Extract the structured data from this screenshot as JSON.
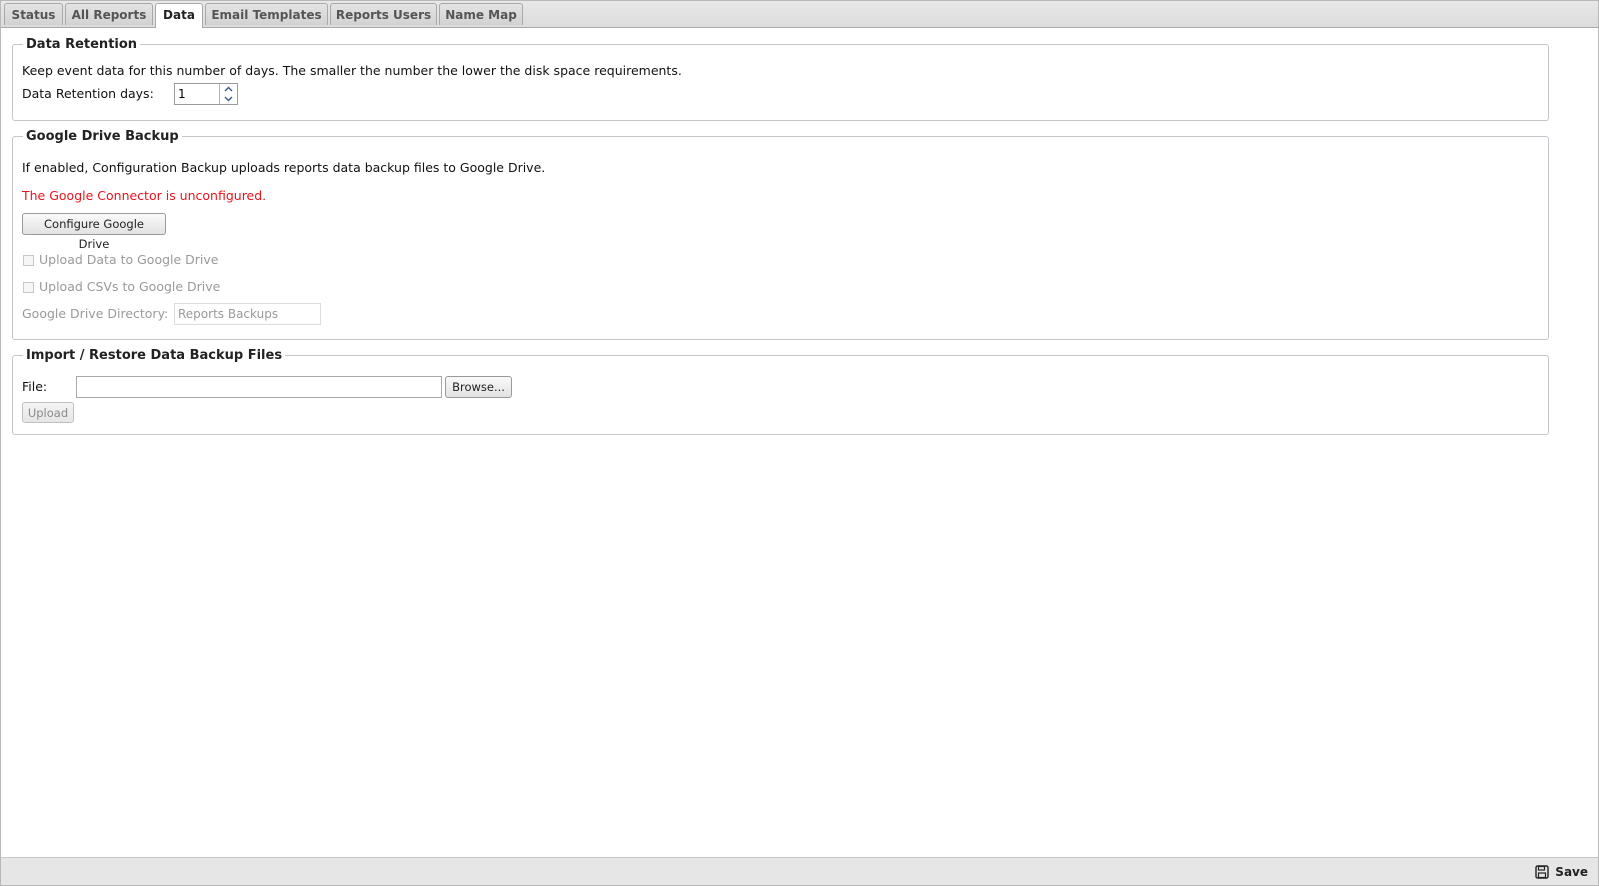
{
  "tabs": [
    {
      "label": "Status"
    },
    {
      "label": "All Reports"
    },
    {
      "label": "Data"
    },
    {
      "label": "Email Templates"
    },
    {
      "label": "Reports Users"
    },
    {
      "label": "Name Map"
    }
  ],
  "active_tab": "Data",
  "retention": {
    "legend": "Data Retention",
    "description": "Keep event data for this number of days. The smaller the number the lower the disk space requirements.",
    "days_label": "Data Retention days:",
    "days_value": "1"
  },
  "gdrive": {
    "legend": "Google Drive Backup",
    "description": "If enabled, Configuration Backup uploads reports data backup files to Google Drive.",
    "warning": "The Google Connector is unconfigured.",
    "warning_color": "#e8141b",
    "configure_label": "Configure Google Drive",
    "upload_data_label": "Upload Data to Google Drive",
    "upload_data_checked": false,
    "upload_csv_label": "Upload CSVs to Google Drive",
    "upload_csv_checked": false,
    "directory_label": "Google Drive Directory:",
    "directory_value": "Reports Backups"
  },
  "restore": {
    "legend": "Import / Restore Data Backup Files",
    "file_label": "File:",
    "file_value": "",
    "browse_label": "Browse...",
    "upload_label": "Upload"
  },
  "footer": {
    "save_label": "Save",
    "save_icon": "floppy-disk-icon"
  }
}
